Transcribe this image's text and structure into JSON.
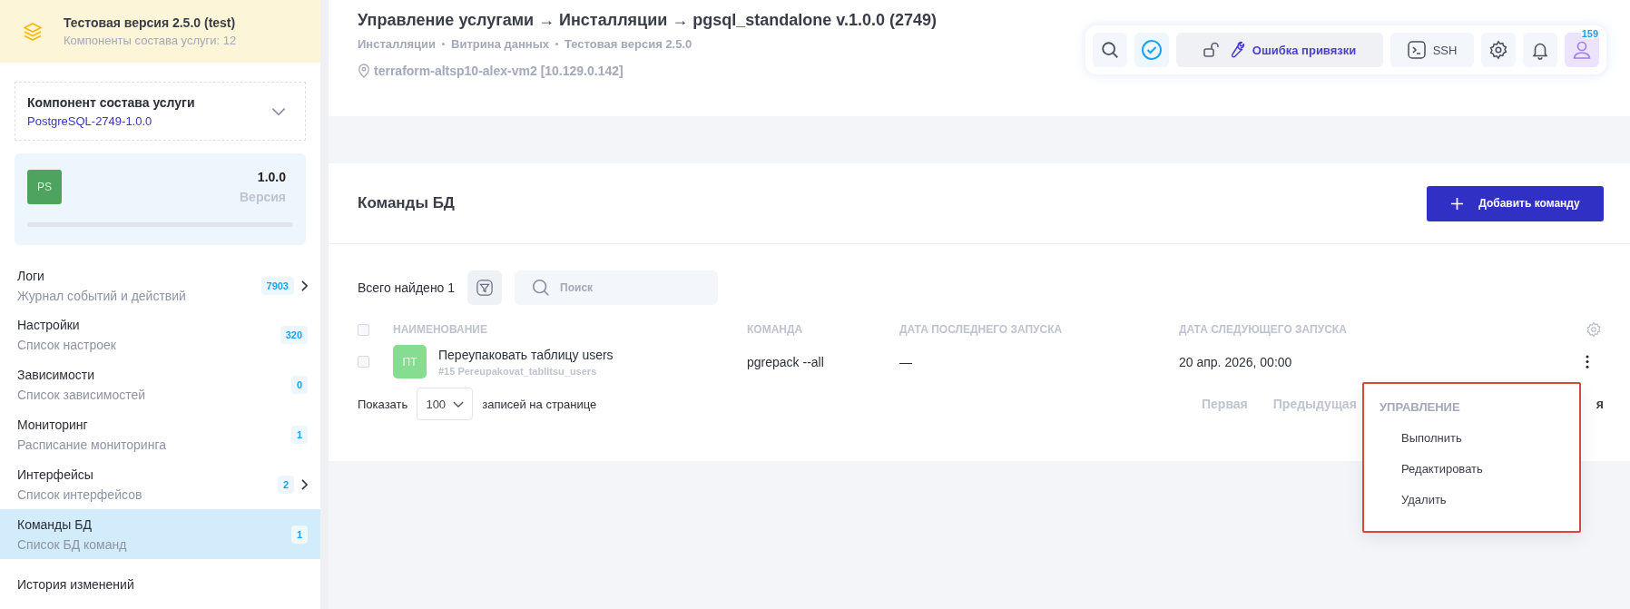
{
  "sidebar": {
    "header": {
      "title": "Тестовая версия 2.5.0 (test)",
      "subtitle": "Компоненты состава услуги: 12"
    },
    "component_select": {
      "label": "Компонент состава услуги",
      "value": "PostgreSQL-2749-1.0.0"
    },
    "version_card": {
      "avatar": "PS",
      "version": "1.0.0",
      "version_label": "Версия"
    },
    "items": [
      {
        "label": "Логи",
        "subtitle": "Журнал событий и действий",
        "badge": "7903",
        "has_submenu": true,
        "selected": false
      },
      {
        "label": "Настройки",
        "subtitle": "Список настроек",
        "badge": "320",
        "has_submenu": false,
        "selected": false
      },
      {
        "label": "Зависимости",
        "subtitle": "Список зависимостей",
        "badge": "0",
        "has_submenu": false,
        "selected": false
      },
      {
        "label": "Мониторинг",
        "subtitle": "Расписание мониторинга",
        "badge": "1",
        "has_submenu": false,
        "selected": false
      },
      {
        "label": "Интерфейсы",
        "subtitle": "Список интерфейсов",
        "badge": "2",
        "has_submenu": true,
        "selected": false
      },
      {
        "label": "Команды БД",
        "subtitle": "Список БД команд",
        "badge": "1",
        "has_submenu": false,
        "selected": true
      },
      {
        "label": "История изменений",
        "has_submenu": false,
        "selected": false
      }
    ]
  },
  "page_header": {
    "title": "Управление услугами → Инсталляции → pgsql_standalone v.1.0.0 (2749)",
    "breadcrumbs": [
      "Инсталляции",
      "Витрина данных",
      "Тестовая версия 2.5.0"
    ],
    "host": "terraform-altsp10-alex-vm2 [10.129.0.142]"
  },
  "toolbar": {
    "binding_button": "Ошибка привязки",
    "ssh_button": "SSH",
    "notification_count": "159"
  },
  "card": {
    "title": "Команды БД",
    "add_button": "Добавить команду",
    "total": "Всего найдено 1",
    "search": {
      "placeholder": "Поиск"
    },
    "table": {
      "select_all": {
        "checked": false
      },
      "columns": [
        "НАИМЕНОВАНИЕ",
        "КОМАНДА",
        "ДАТА ПОСЛЕДНЕГО ЗАПУСКА",
        "ДАТА СЛЕДУЮЩЕГО ЗАПУСКА"
      ],
      "rows": [
        {
          "checked": false,
          "avatar": "ПТ",
          "name": "Переупаковать таблицу users",
          "slug": "#15 Pereupakovat_tablitsu_users",
          "command": "pgrepack --all",
          "last_run": "—",
          "next_run": "20 апр. 2026, 00:00"
        }
      ]
    },
    "page_size_label": "Показать",
    "page_size": "100",
    "page_size_suffix": "записей на странице",
    "pagination": [
      "Первая",
      "Предыдущая",
      "я"
    ]
  },
  "context_menu": {
    "title": "УПРАВЛЕНИЕ",
    "items": [
      "Выполнить",
      "Редактировать",
      "Удалить"
    ]
  }
}
